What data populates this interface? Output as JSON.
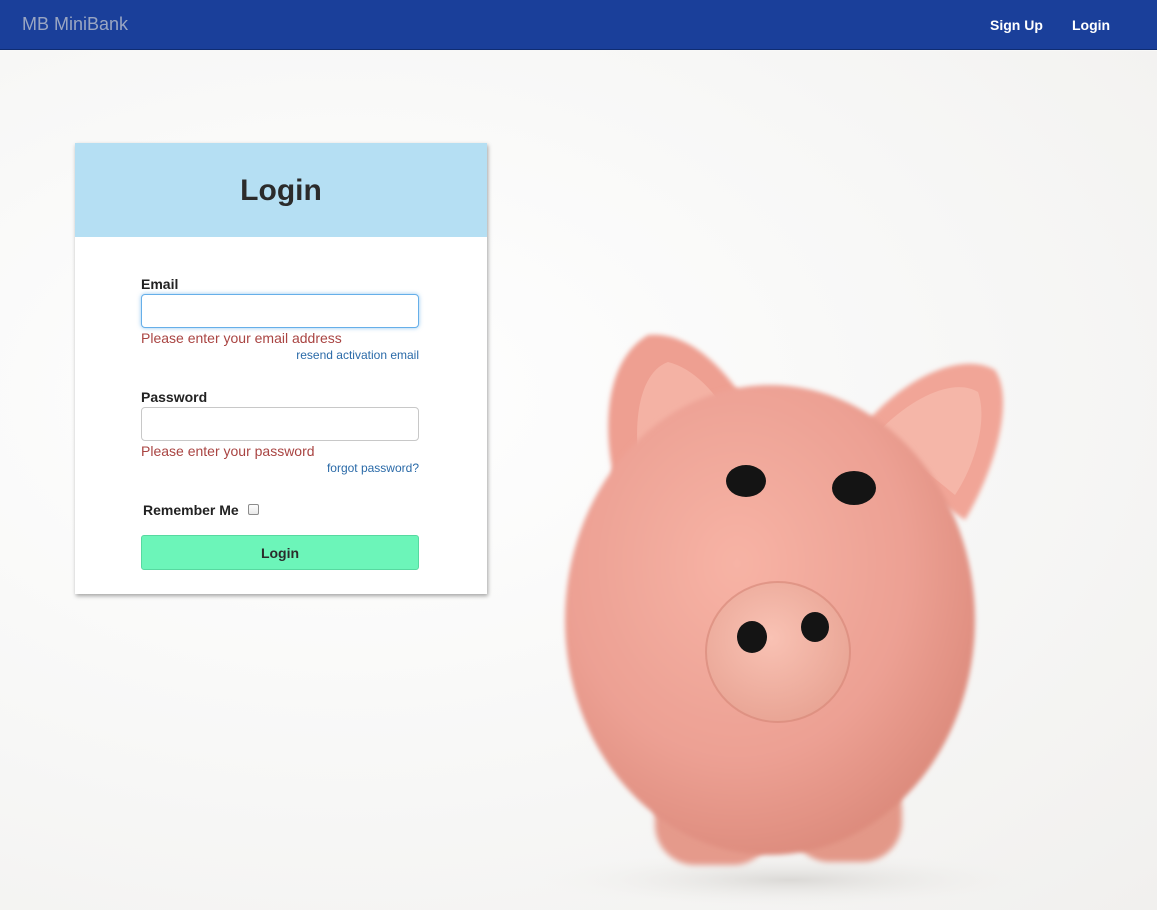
{
  "navbar": {
    "brand": "MB MiniBank",
    "links": [
      {
        "label": "Sign Up"
      },
      {
        "label": "Login"
      }
    ]
  },
  "login_card": {
    "title": "Login",
    "email": {
      "label": "Email",
      "value": "",
      "error": "Please enter your email address",
      "link": "resend activation email"
    },
    "password": {
      "label": "Password",
      "value": "",
      "error": "Please enter your password",
      "link": "forgot password?"
    },
    "remember_me": {
      "label": "Remember Me",
      "checked": false
    },
    "submit_label": "Login"
  },
  "hero_image": {
    "subject": "piggy-bank"
  },
  "colors": {
    "navbar": "#1a3f9a",
    "card_header": "#b5dff3",
    "error_text": "#a94442",
    "link_text": "#2a6aa8",
    "submit_button": "#6cf5b9"
  }
}
